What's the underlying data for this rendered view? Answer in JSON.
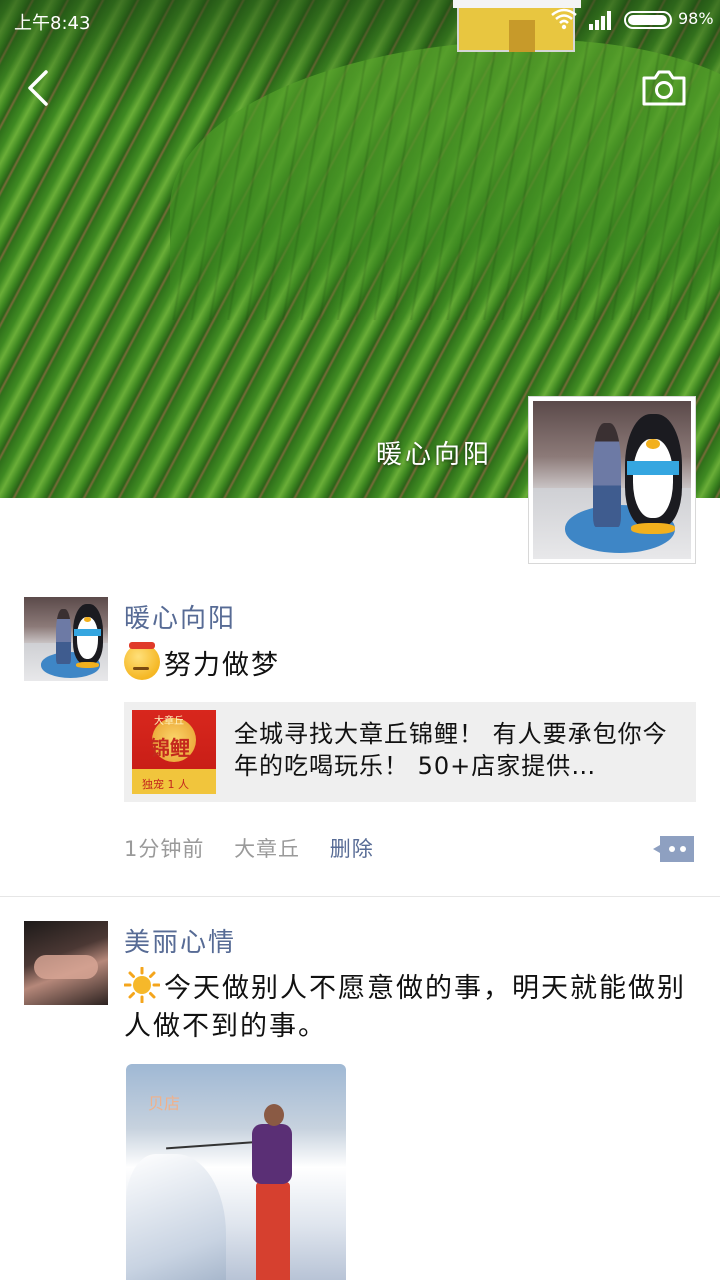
{
  "status_bar": {
    "time": "上午8:43",
    "battery_percent": "98%",
    "battery_level": 0.98
  },
  "header": {
    "back_icon": "chevron-left-icon",
    "camera_icon": "camera-icon"
  },
  "profile": {
    "name": "暖心向阳"
  },
  "posts": [
    {
      "author": "暖心向阳",
      "emoji": "angry-face-emoji",
      "text": "努力做梦",
      "link": {
        "title": "全城寻找大章丘锦鲤！ 有人要承包你今年的吃喝玩乐！ 50+店家提供…",
        "thumb_top_text": "大章丘",
        "thumb_main_text": "锦鲤",
        "thumb_tag": "独宠 1 人"
      },
      "time": "1分钟前",
      "location": "大章丘",
      "delete_label": "删除"
    },
    {
      "author": "美丽心情",
      "emoji": "sun-emoji",
      "text": "今天做别人不愿意做的事，明天就能做别人做不到的事。",
      "image_watermark": "贝店"
    }
  ],
  "colors": {
    "link_blue": "#576b95",
    "meta_gray": "#9a9a9a",
    "card_bg": "#efefef"
  }
}
